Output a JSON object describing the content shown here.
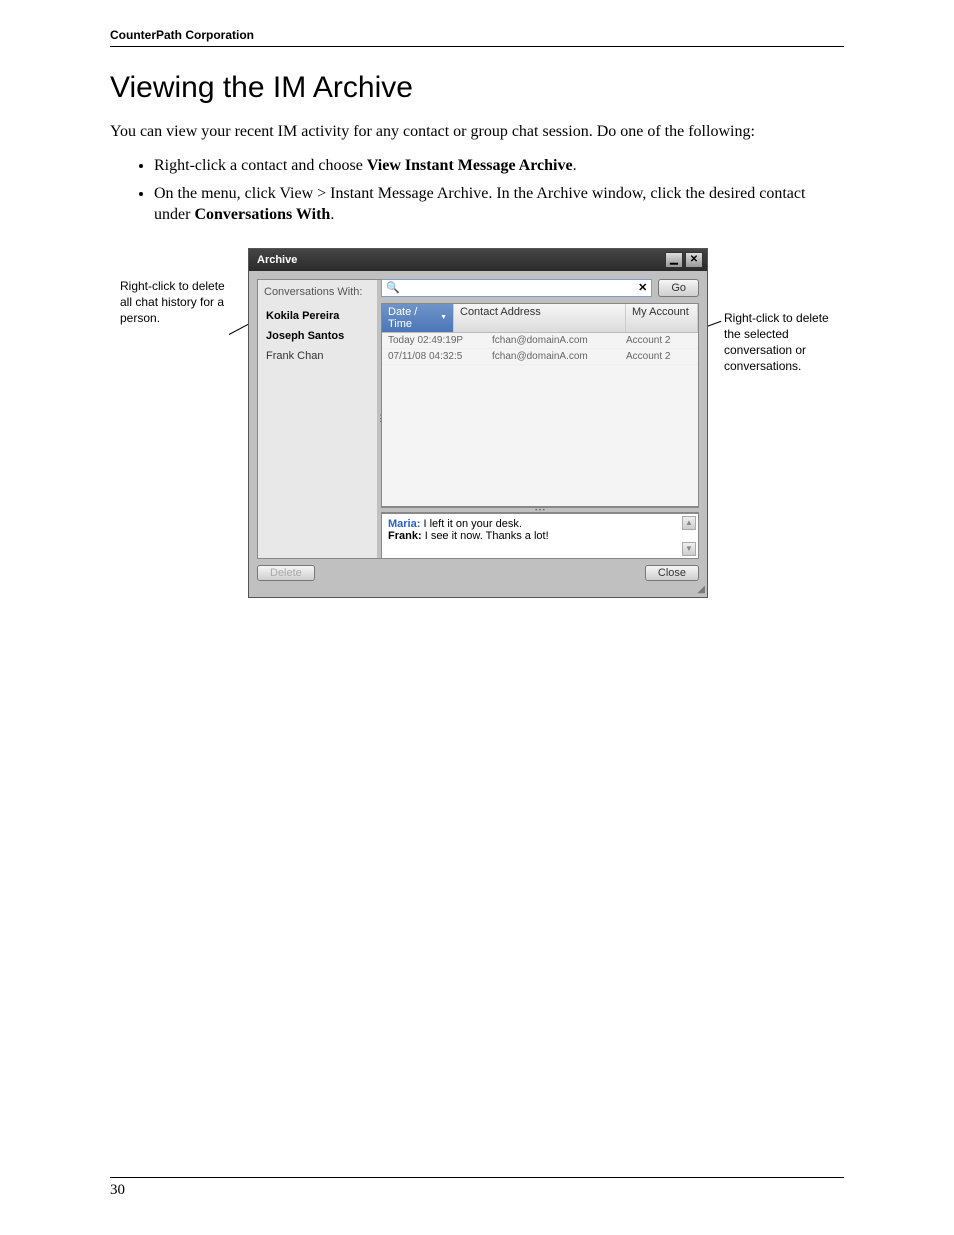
{
  "doc": {
    "header": "CounterPath Corporation",
    "title": "Viewing the IM Archive",
    "intro": "You can view your recent IM activity for any contact or group chat session. Do one of the following:",
    "bullet1_pre": "Right-click a contact and choose ",
    "bullet1_bold": "View Instant Message Archive",
    "bullet1_post": ".",
    "bullet2_pre": "On the menu, click View > Instant Message Archive. In the Archive window, click the desired contact under ",
    "bullet2_bold": "Conversations With",
    "bullet2_post": ".",
    "page_number": "30"
  },
  "callouts": {
    "left": "Right-click to delete all chat history for a person.",
    "right": "Right-click to delete the selected conversation or conversations."
  },
  "archive": {
    "title": "Archive",
    "conversations_with_label": "Conversations With:",
    "contacts": [
      "Kokila Pereira",
      "Joseph Santos",
      "Frank Chan"
    ],
    "go_label": "Go",
    "columns": {
      "date": "Date / Time",
      "contact": "Contact Address",
      "account": "My Account"
    },
    "rows": [
      {
        "date": "Today 02:49:19P",
        "contact": "fchan@domainA.com",
        "account": "Account 2"
      },
      {
        "date": "07/11/08 04:32:5",
        "contact": "fchan@domainA.com",
        "account": "Account 2"
      }
    ],
    "messages": [
      {
        "sender": "Maria",
        "text": "I left it on your desk.",
        "blue": true
      },
      {
        "sender": "Frank",
        "text": "I see it now. Thanks a lot!",
        "blue": false
      }
    ],
    "delete_label": "Delete",
    "close_label": "Close"
  }
}
